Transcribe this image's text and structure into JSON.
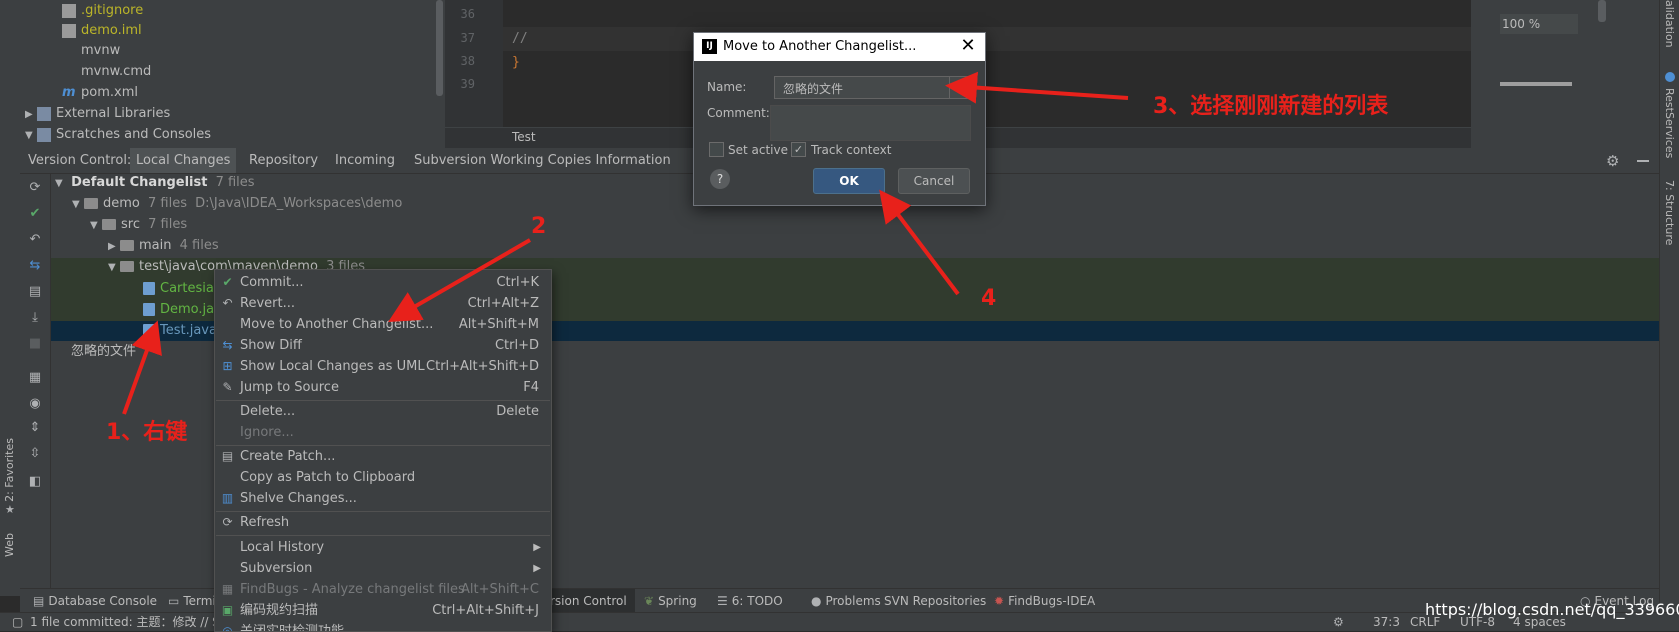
{
  "project_tree": [
    {
      "label": ".gitignore",
      "style": "yellow"
    },
    {
      "label": "demo.iml",
      "style": "yellow"
    },
    {
      "label": "mvnw",
      "style": "plain"
    },
    {
      "label": "mvnw.cmd",
      "style": "plain"
    },
    {
      "label": "pom.xml",
      "style": "plain"
    },
    {
      "label": "External Libraries",
      "style": "plain"
    },
    {
      "label": "Scratches and Consoles",
      "style": "plain"
    }
  ],
  "editor": {
    "line_numbers": [
      "36",
      "37",
      "38",
      "39"
    ],
    "code_line_37": "//",
    "code_line_38": "}",
    "breadcrumb": "Test",
    "zoom": "100 %"
  },
  "right_strip": {
    "validation": "alidation",
    "restservices": "RestServices",
    "structure": "7: Structure"
  },
  "left_strip": {
    "favorites": "2: Favorites",
    "web": "Web"
  },
  "vc_tabs": {
    "title": "Version Control:",
    "tabs": [
      "Local Changes",
      "Repository",
      "Incoming",
      "Subversion Working Copies Information"
    ]
  },
  "changes_tree": {
    "default_changelist": "Default Changelist",
    "default_count": "7 files",
    "demo": "demo",
    "demo_count": "7 files",
    "demo_path": "D:\\Java\\IDEA_Workspaces\\demo",
    "src": "src",
    "src_count": "7 files",
    "main": "main",
    "main_count": "4 files",
    "test_path": "test\\java\\com\\maven\\demo",
    "test_count": "3 files",
    "file1": "Cartesian",
    "file2": "Demo.jav",
    "file3": "Test.java",
    "ignored_list": "忽略的文件"
  },
  "context_menu": [
    {
      "label": "Commit...",
      "key": "Ctrl+K",
      "icon": "check-icon"
    },
    {
      "label": "Revert...",
      "key": "Ctrl+Alt+Z",
      "icon": "revert-icon"
    },
    {
      "label": "Move to Another Changelist...",
      "key": "Alt+Shift+M",
      "icon": ""
    },
    {
      "label": "Show Diff",
      "key": "Ctrl+D",
      "icon": "diff-icon"
    },
    {
      "label": "Show Local Changes as UML",
      "key": "Ctrl+Alt+Shift+D",
      "icon": "uml-icon"
    },
    {
      "label": "Jump to Source",
      "key": "F4",
      "icon": "pencil-icon"
    },
    {
      "label": "Delete...",
      "key": "Delete",
      "icon": ""
    },
    {
      "label": "Ignore...",
      "key": "",
      "icon": ""
    },
    {
      "label": "Create Patch...",
      "key": "",
      "icon": "patch-icon"
    },
    {
      "label": "Copy as Patch to Clipboard",
      "key": "",
      "icon": ""
    },
    {
      "label": "Shelve Changes...",
      "key": "",
      "icon": "shelve-icon"
    },
    {
      "label": "Refresh",
      "key": "",
      "icon": "refresh-icon"
    },
    {
      "label": "Local History",
      "key": "",
      "icon": ""
    },
    {
      "label": "Subversion",
      "key": "",
      "icon": ""
    },
    {
      "label": "FindBugs - Analyze changelist files",
      "key": "Alt+Shift+C",
      "icon": "findbugs-icon"
    },
    {
      "label": "编码规约扫描",
      "key": "Ctrl+Alt+Shift+J",
      "icon": "scan-icon"
    },
    {
      "label": "关闭实时检测功能",
      "key": "",
      "icon": "scan-icon"
    }
  ],
  "dialog": {
    "title": "Move to Another Changelist...",
    "name_label": "Name:",
    "name_value": "忽略的文件",
    "comment_label": "Comment:",
    "set_active": "Set active",
    "track_context": "Track context",
    "ok": "OK",
    "cancel": "Cancel",
    "help": "?"
  },
  "bottom_tools": [
    "Database Console",
    "Termi",
    "rsion Control",
    "Spring",
    "6: TODO",
    "Problems",
    "SVN Repositories",
    "FindBugs-IDEA",
    "Event Log"
  ],
  "status": {
    "message": "1 file committed: 主题：修改 // S",
    "position": "37:3",
    "line_sep": "CRLF",
    "encoding": "UTF-8",
    "indent": "4 spaces",
    "watermark": "https://blog.csdn.net/qq_33966061"
  },
  "annotations": {
    "a1": "1、右键",
    "a2": "2",
    "a3": "3、选择刚刚新建的列表",
    "a4": "4"
  }
}
